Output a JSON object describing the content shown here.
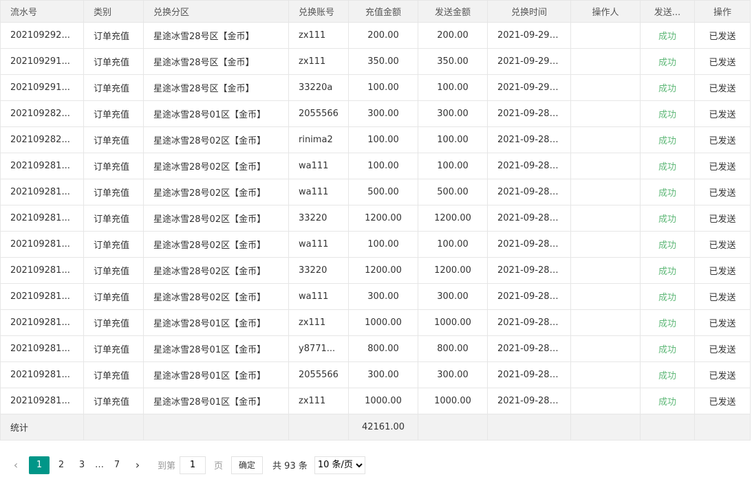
{
  "columns": [
    "流水号",
    "类别",
    "兑换分区",
    "兑换账号",
    "充值金额",
    "发送金额",
    "兑换时间",
    "操作人",
    "发送...",
    "操作"
  ],
  "rows": [
    {
      "serial": "202109292...",
      "category": "订单充值",
      "zone": "星途冰雪28号区【金币】",
      "account": "zx111",
      "recharge": "200.00",
      "sent": "200.00",
      "time": "2021-09-29 ...",
      "operator": "",
      "status": "成功",
      "action": "已发送"
    },
    {
      "serial": "202109291...",
      "category": "订单充值",
      "zone": "星途冰雪28号区【金币】",
      "account": "zx111",
      "recharge": "350.00",
      "sent": "350.00",
      "time": "2021-09-29 ...",
      "operator": "",
      "status": "成功",
      "action": "已发送"
    },
    {
      "serial": "202109291...",
      "category": "订单充值",
      "zone": "星途冰雪28号区【金币】",
      "account": "33220a",
      "recharge": "100.00",
      "sent": "100.00",
      "time": "2021-09-29 ...",
      "operator": "",
      "status": "成功",
      "action": "已发送"
    },
    {
      "serial": "202109282...",
      "category": "订单充值",
      "zone": "星途冰雪28号01区【金币】",
      "account": "2055566",
      "recharge": "300.00",
      "sent": "300.00",
      "time": "2021-09-28 ...",
      "operator": "",
      "status": "成功",
      "action": "已发送"
    },
    {
      "serial": "202109282...",
      "category": "订单充值",
      "zone": "星途冰雪28号02区【金币】",
      "account": "rinima2",
      "recharge": "100.00",
      "sent": "100.00",
      "time": "2021-09-28 ...",
      "operator": "",
      "status": "成功",
      "action": "已发送"
    },
    {
      "serial": "202109281...",
      "category": "订单充值",
      "zone": "星途冰雪28号02区【金币】",
      "account": "wa111",
      "recharge": "100.00",
      "sent": "100.00",
      "time": "2021-09-28 ...",
      "operator": "",
      "status": "成功",
      "action": "已发送"
    },
    {
      "serial": "202109281...",
      "category": "订单充值",
      "zone": "星途冰雪28号02区【金币】",
      "account": "wa111",
      "recharge": "500.00",
      "sent": "500.00",
      "time": "2021-09-28 ...",
      "operator": "",
      "status": "成功",
      "action": "已发送"
    },
    {
      "serial": "202109281...",
      "category": "订单充值",
      "zone": "星途冰雪28号02区【金币】",
      "account": "33220",
      "recharge": "1200.00",
      "sent": "1200.00",
      "time": "2021-09-28 ...",
      "operator": "",
      "status": "成功",
      "action": "已发送"
    },
    {
      "serial": "202109281...",
      "category": "订单充值",
      "zone": "星途冰雪28号02区【金币】",
      "account": "wa111",
      "recharge": "100.00",
      "sent": "100.00",
      "time": "2021-09-28 ...",
      "operator": "",
      "status": "成功",
      "action": "已发送"
    },
    {
      "serial": "202109281...",
      "category": "订单充值",
      "zone": "星途冰雪28号02区【金币】",
      "account": "33220",
      "recharge": "1200.00",
      "sent": "1200.00",
      "time": "2021-09-28 ...",
      "operator": "",
      "status": "成功",
      "action": "已发送"
    },
    {
      "serial": "202109281...",
      "category": "订单充值",
      "zone": "星途冰雪28号02区【金币】",
      "account": "wa111",
      "recharge": "300.00",
      "sent": "300.00",
      "time": "2021-09-28 ...",
      "operator": "",
      "status": "成功",
      "action": "已发送"
    },
    {
      "serial": "202109281...",
      "category": "订单充值",
      "zone": "星途冰雪28号01区【金币】",
      "account": "zx111",
      "recharge": "1000.00",
      "sent": "1000.00",
      "time": "2021-09-28 ...",
      "operator": "",
      "status": "成功",
      "action": "已发送"
    },
    {
      "serial": "202109281...",
      "category": "订单充值",
      "zone": "星途冰雪28号01区【金币】",
      "account": "y8771...",
      "recharge": "800.00",
      "sent": "800.00",
      "time": "2021-09-28 ...",
      "operator": "",
      "status": "成功",
      "action": "已发送"
    },
    {
      "serial": "202109281...",
      "category": "订单充值",
      "zone": "星途冰雪28号01区【金币】",
      "account": "2055566",
      "recharge": "300.00",
      "sent": "300.00",
      "time": "2021-09-28 ...",
      "operator": "",
      "status": "成功",
      "action": "已发送"
    },
    {
      "serial": "202109281...",
      "category": "订单充值",
      "zone": "星途冰雪28号01区【金币】",
      "account": "zx111",
      "recharge": "1000.00",
      "sent": "1000.00",
      "time": "2021-09-28 ...",
      "operator": "",
      "status": "成功",
      "action": "已发送"
    }
  ],
  "totals": {
    "label": "统计",
    "recharge": "42161.00"
  },
  "pager": {
    "prev_icon": "chevron-left-icon",
    "next_icon": "chevron-right-icon",
    "pages": [
      "1",
      "2",
      "3"
    ],
    "ellipsis": "…",
    "last_page": "7",
    "current_page": "1",
    "goto_label": "到第",
    "goto_value": "1",
    "page_unit": "页",
    "confirm_label": "确定",
    "total_text": "共 93 条",
    "page_size_options": [
      "10 条/页"
    ],
    "page_size_selected": "10 条/页"
  },
  "colors": {
    "status_ok": "#5FB878",
    "active_page": "#009688",
    "header_bg": "#f2f2f2",
    "border": "#e6e6e6"
  }
}
